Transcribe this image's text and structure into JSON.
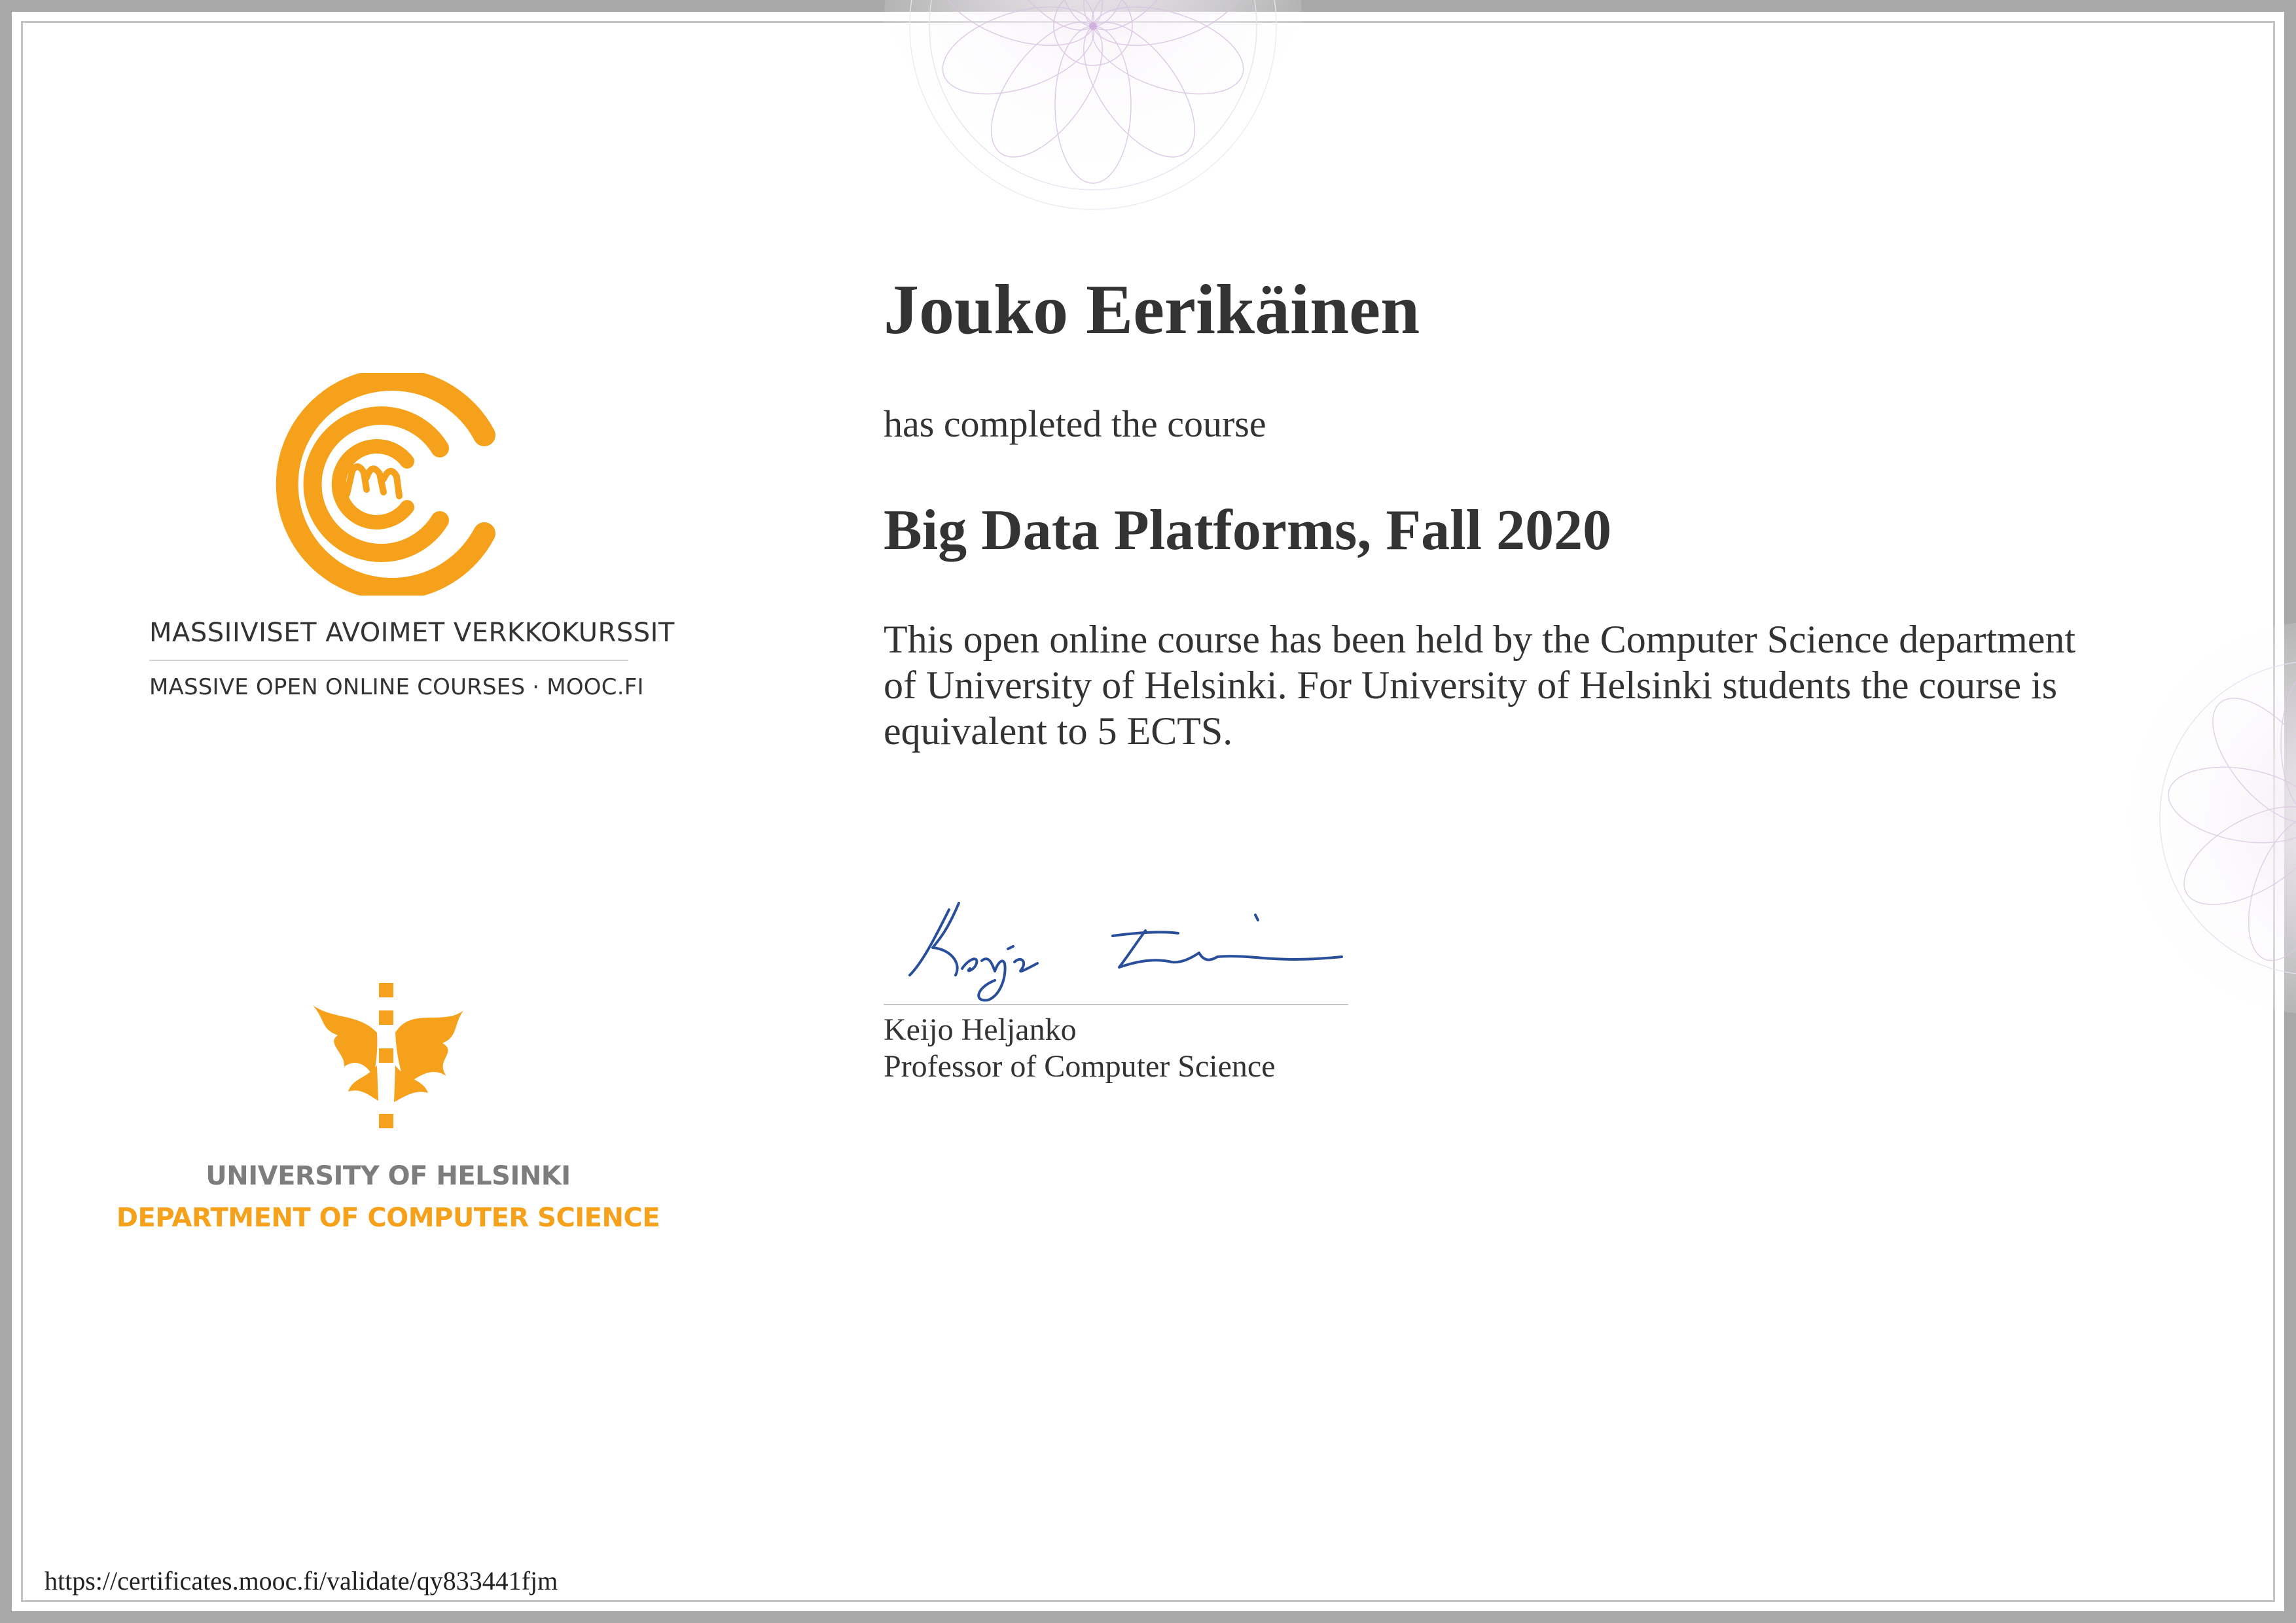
{
  "certificate": {
    "recipient_name": "Jouko Eerikäinen",
    "completed_text": "has completed the course",
    "course_title": "Big Data Platforms, Fall 2020",
    "description": "This open online course has been held by the Computer Science department of University of Helsinki. For University of Helsinki students the course is equivalent to 5 ECTS."
  },
  "mooc_branding": {
    "line1": "MASSIIVISET AVOIMET VERKKOKURSSIT",
    "line2": "MASSIVE OPEN ONLINE COURSES · MOOC.FI",
    "logo_icon": "mooc-spiral-logo-icon"
  },
  "university_branding": {
    "name": "UNIVERSITY OF HELSINKI",
    "department": "DEPARTMENT OF COMPUTER SCIENCE",
    "logo_icon": "helsinki-flame-logo-icon"
  },
  "signatory": {
    "name": "Keijo Heljanko",
    "title": "Professor of Computer Science",
    "signature_icon": "handwritten-signature-icon"
  },
  "footer": {
    "validation_url": "https://certificates.mooc.fi/validate/qy833441fjm"
  },
  "colors": {
    "accent_orange": "#f5a11b",
    "text_dark": "#333333",
    "uh_gray": "#7d7d7d",
    "signature_blue": "#2a4f9a",
    "rosette_purple": "#c9a9d6"
  }
}
